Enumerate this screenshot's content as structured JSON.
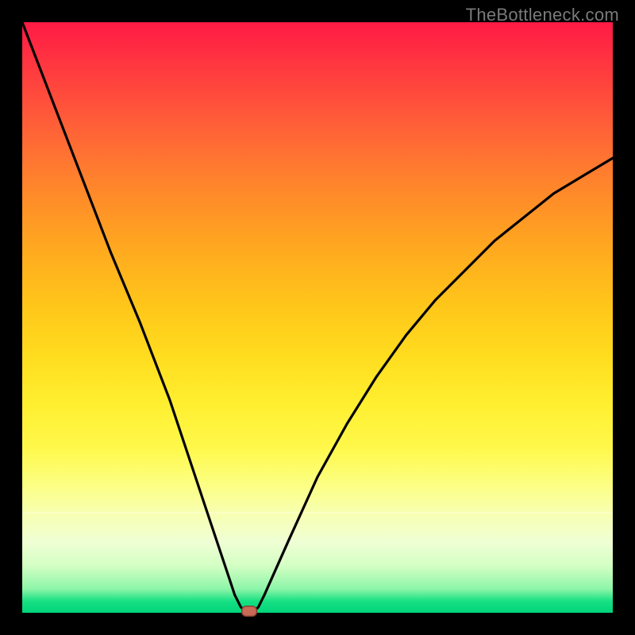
{
  "watermark": "TheBottleneck.com",
  "chart_data": {
    "type": "line",
    "title": "",
    "xlabel": "",
    "ylabel": "",
    "xlim": [
      0,
      100
    ],
    "ylim": [
      0,
      100
    ],
    "series": [
      {
        "name": "bottleneck-curve",
        "x": [
          0,
          5,
          10,
          15,
          20,
          25,
          28,
          31,
          33,
          35,
          36,
          37,
          38,
          39,
          40,
          41,
          45,
          50,
          55,
          60,
          65,
          70,
          75,
          80,
          85,
          90,
          95,
          100
        ],
        "values": [
          100,
          87,
          74,
          61,
          49,
          36,
          27,
          18,
          12,
          6,
          3,
          1,
          0,
          0,
          1,
          3,
          12,
          23,
          32,
          40,
          47,
          53,
          58,
          63,
          67,
          71,
          74,
          77
        ]
      }
    ],
    "marker": {
      "x": 38.5,
      "y": 0
    },
    "gradient_stops": [
      {
        "pos": 0,
        "color": "#ff1a45"
      },
      {
        "pos": 50,
        "color": "#ffc61a"
      },
      {
        "pos": 80,
        "color": "#fcff80"
      },
      {
        "pos": 100,
        "color": "#00d47a"
      }
    ],
    "white_band_center_pct": 83
  }
}
